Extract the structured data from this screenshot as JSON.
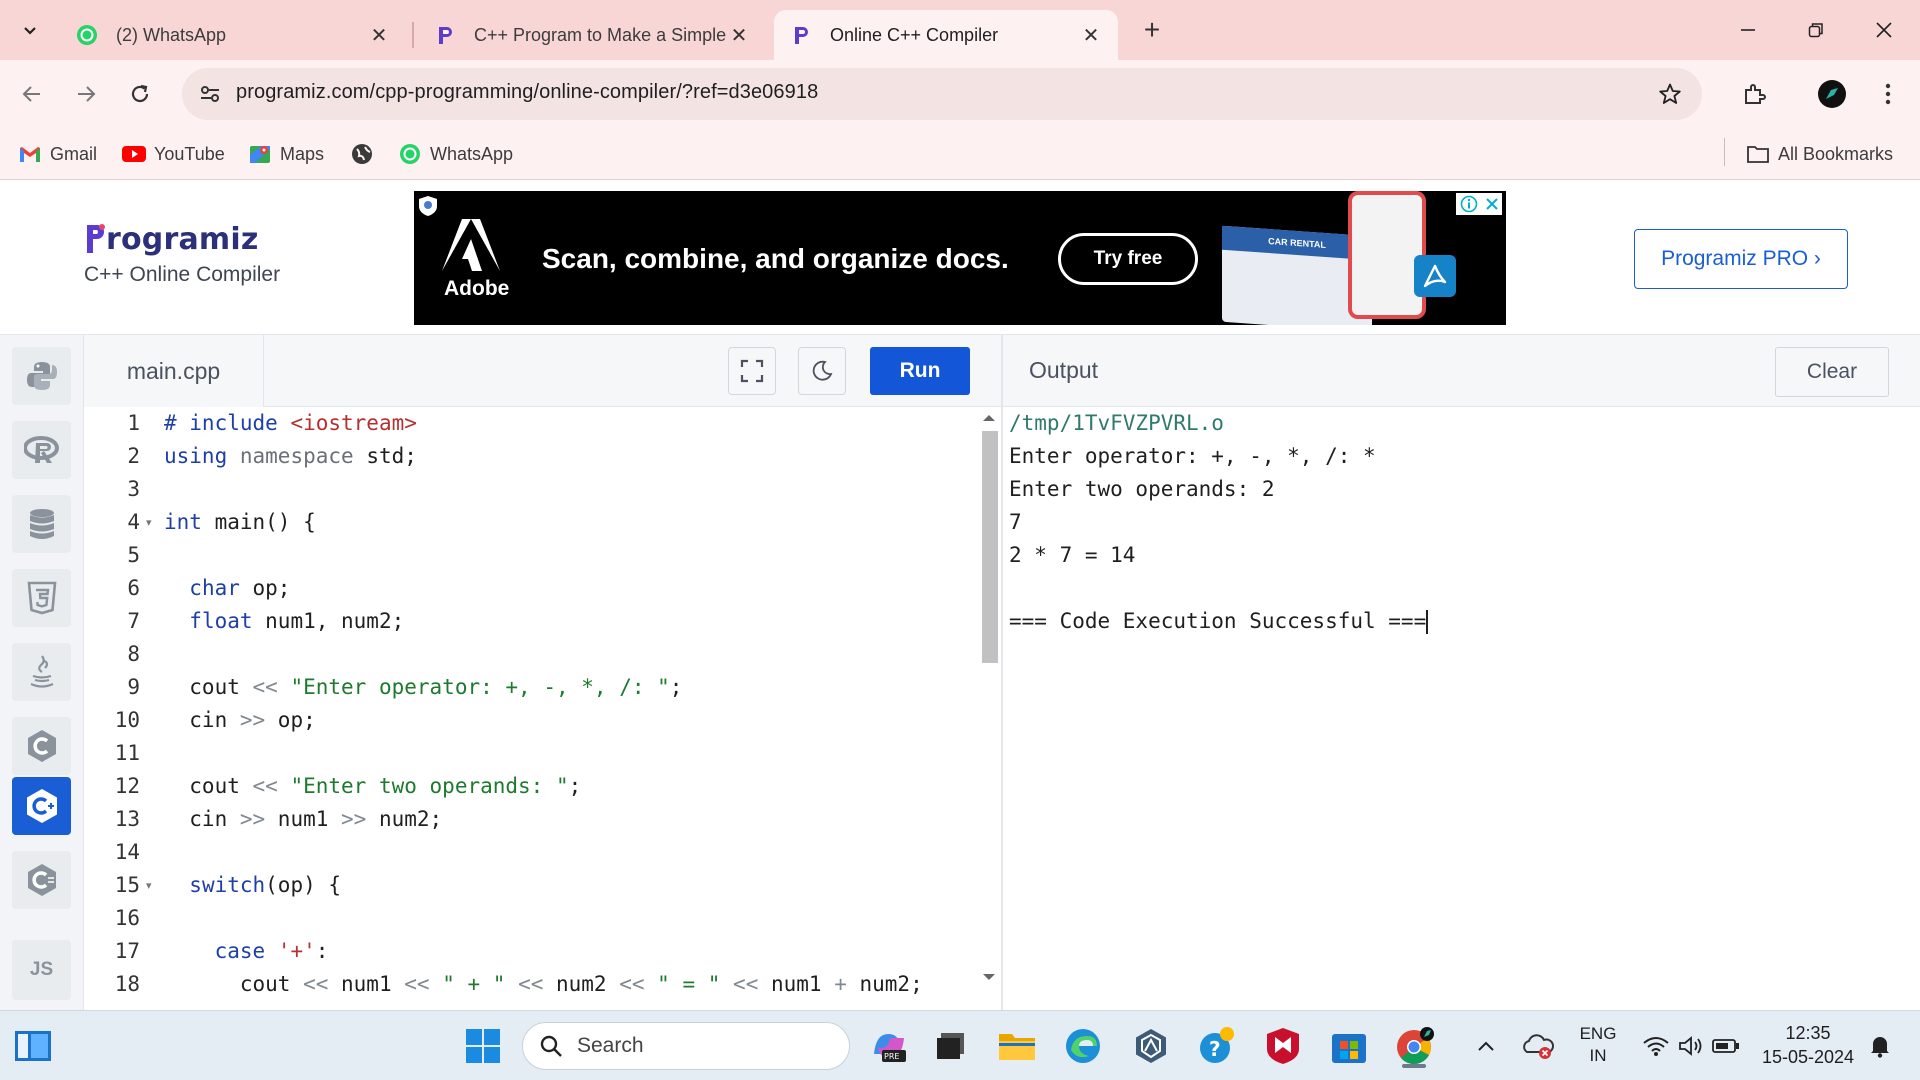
{
  "browser": {
    "tabs": [
      {
        "title": "(2) WhatsApp",
        "active": false
      },
      {
        "title": "C++ Program to Make a Simple",
        "active": false
      },
      {
        "title": "Online C++ Compiler",
        "active": true
      }
    ],
    "url": "programiz.com/cpp-programming/online-compiler/?ref=d3e06918",
    "bookmarks": [
      "Gmail",
      "YouTube",
      "Maps",
      "WhatsApp"
    ],
    "all_bookmarks_label": "All Bookmarks"
  },
  "header": {
    "logo_text": "rogramiz",
    "subtitle": "C++ Online Compiler",
    "pro_button": "Programiz PRO ›"
  },
  "ad": {
    "brand": "Adobe",
    "headline": "Scan, combine, and organize docs.",
    "cta": "Try free",
    "card_label": "CAR RENTAL"
  },
  "editor": {
    "file_name": "main.cpp",
    "run_label": "Run",
    "line_numbers": [
      "1",
      "2",
      "3",
      "4",
      "5",
      "6",
      "7",
      "8",
      "9",
      "10",
      "11",
      "12",
      "13",
      "14",
      "15",
      "16",
      "17",
      "18"
    ],
    "fold_lines": [
      4,
      15
    ]
  },
  "output": {
    "title": "Output",
    "clear_label": "Clear",
    "lines": [
      "/tmp/1TvFVZPVRL.o",
      "Enter operator: +, -, *, /: *",
      "Enter two operands: 2",
      "7",
      "2 * 7 = 14",
      "",
      "=== Code Execution Successful ==="
    ]
  },
  "sidebar": {
    "languages": [
      "python-icon",
      "r-icon",
      "sql-icon",
      "html5-icon",
      "java-icon",
      "c-icon",
      "cpp-icon",
      "csharp-icon",
      "js-icon"
    ],
    "active": "cpp-icon",
    "js_label": "JS"
  },
  "taskbar": {
    "search_placeholder": "Search",
    "lang_top": "ENG",
    "lang_bottom": "IN",
    "time": "12:35",
    "date": "15-05-2024"
  },
  "colors": {
    "accent": "#1357d8",
    "tabstrip": "#f9d6d6",
    "keyword": "#1e3fa8",
    "string": "#1d7a2e"
  }
}
